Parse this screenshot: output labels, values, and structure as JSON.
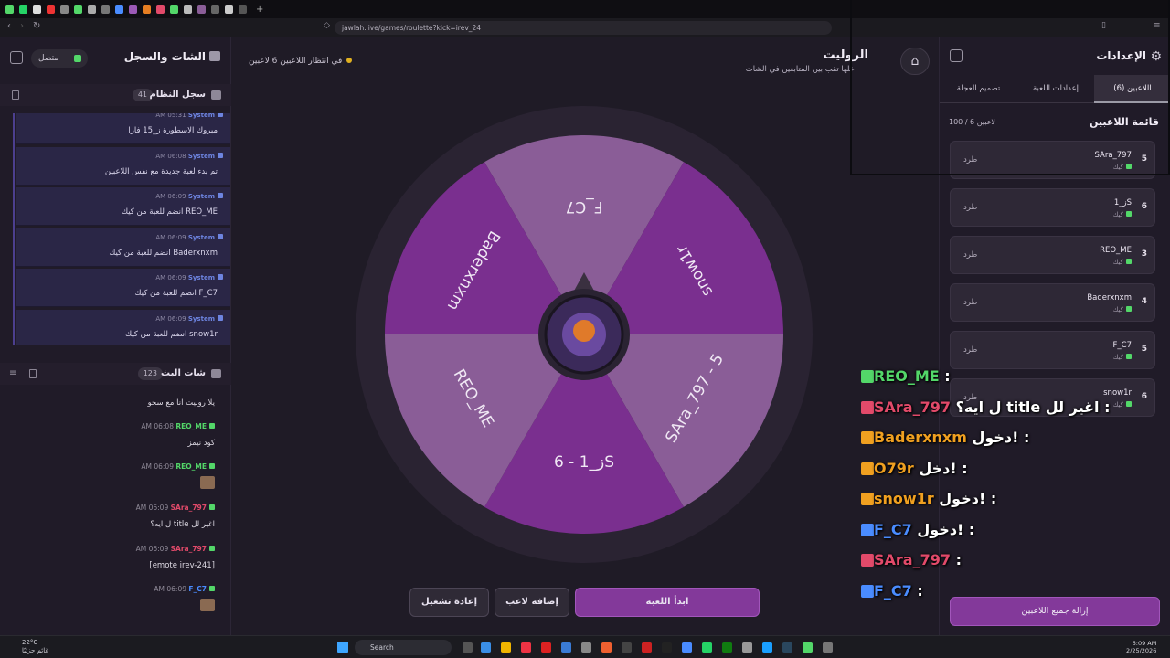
{
  "browser": {
    "url": "jawlah.live/games/roulette?kick=irev_24"
  },
  "left_panel": {
    "title": "الشات والسجل",
    "status": "متصل",
    "system_log": {
      "title": "سجل النظام",
      "count": "41",
      "messages": [
        {
          "user": "System",
          "time": "AM 05:31",
          "text": "مبروك الاسطورة ز_15 فازا"
        },
        {
          "user": "System",
          "time": "AM 06:08",
          "text": "تم بدء لعبة جديدة مع نفس اللاعبين"
        },
        {
          "user": "System",
          "time": "AM 06:09",
          "text": "REO_ME انضم للعبة من كيك"
        },
        {
          "user": "System",
          "time": "AM 06:09",
          "text": "Baderxnxm انضم للعبة من كيك"
        },
        {
          "user": "System",
          "time": "AM 06:09",
          "text": "F_C7 انضم للعبة من كيك"
        },
        {
          "user": "System",
          "time": "AM 06:09",
          "text": "snow1r انضم للعبة من كيك"
        }
      ]
    },
    "live_chat": {
      "title": "شات البث",
      "count": "123",
      "messages": [
        {
          "user": "",
          "time": "",
          "text": "يلا روليت انا مع سجو",
          "color": "#e24a6a"
        },
        {
          "user": "REO_ME",
          "time": "AM 06:08",
          "text": "كود نيمز",
          "color": "#53d769"
        },
        {
          "user": "REO_ME",
          "time": "AM 06:09",
          "text": "",
          "color": "#53d769",
          "emote": true
        },
        {
          "user": "SAra_797",
          "time": "AM 06:09",
          "text": "اغير لل title ل ايه؟",
          "color": "#e24a6a"
        },
        {
          "user": "SAra_797",
          "time": "AM 06:09",
          "text": "[emote irev-241]",
          "color": "#e24a6a"
        },
        {
          "user": "F_C7",
          "time": "AM 06:09",
          "text": "",
          "color": "#4a8cff",
          "emote": true
        }
      ]
    }
  },
  "game": {
    "status_players": "6 لاعبين",
    "status_waiting": "في انتظار اللاعبين",
    "title": "الروليت",
    "subtitle": "خلها تقب بين المتابعين في الشات",
    "wheel_segments": [
      "F_C7",
      "snow1r",
      "SAra_797 - 5",
      "6 - ز_1S",
      "REO_ME",
      "Baderxnxm"
    ],
    "buttons": {
      "start": "ابدأ اللعبة",
      "add_player": "إضافة لاعب",
      "restart": "إعادة تشغيل"
    }
  },
  "overlay_chat": [
    {
      "name": "REO_ME",
      "text": ":",
      "color": "#53d769"
    },
    {
      "name": "SAra_797",
      "text": "ل ايه؟ title اغير لل :",
      "color": "#e24a6a"
    },
    {
      "name": "Baderxnxm",
      "text": "دخول! :",
      "color": "#f0a020"
    },
    {
      "name": "O79r",
      "text": "دخل! :",
      "color": "#f0a020"
    },
    {
      "name": "snow1r",
      "text": "دخول! :",
      "color": "#f0a020"
    },
    {
      "name": "F_C7",
      "text": "دخول! :",
      "color": "#4a8cff"
    },
    {
      "name": "SAra_797",
      "text": ":",
      "color": "#e24a6a"
    },
    {
      "name": "F_C7",
      "text": ":",
      "color": "#4a8cff"
    }
  ],
  "right_panel": {
    "title": "الإعدادات",
    "tabs": [
      "اللاعبين (6)",
      "إعدادات اللعبة",
      "تصميم العجلة"
    ],
    "players_title": "قائمة اللاعبين",
    "players_count": "100 / 6 لاعبين",
    "kick_label": "طرد",
    "platform": "كيك",
    "players": [
      {
        "name": "SAra_797",
        "score": "5"
      },
      {
        "name": "ز_1S",
        "score": "6"
      },
      {
        "name": "REO_ME",
        "score": "3"
      },
      {
        "name": "Baderxnxm",
        "score": "4"
      },
      {
        "name": "F_C7",
        "score": "5"
      },
      {
        "name": "snow1r",
        "score": "6"
      }
    ],
    "clear_button": "إزالة جميع اللاعبين"
  },
  "taskbar": {
    "weather_temp": "22°C",
    "weather_desc": "غائم جزئيًا",
    "search": "Search",
    "time": "6:09 AM",
    "date": "2/25/2026"
  },
  "colors": {
    "accent": "#83399a",
    "wheel_dark": "#7a2f8f",
    "wheel_light": "#8a5d97"
  }
}
